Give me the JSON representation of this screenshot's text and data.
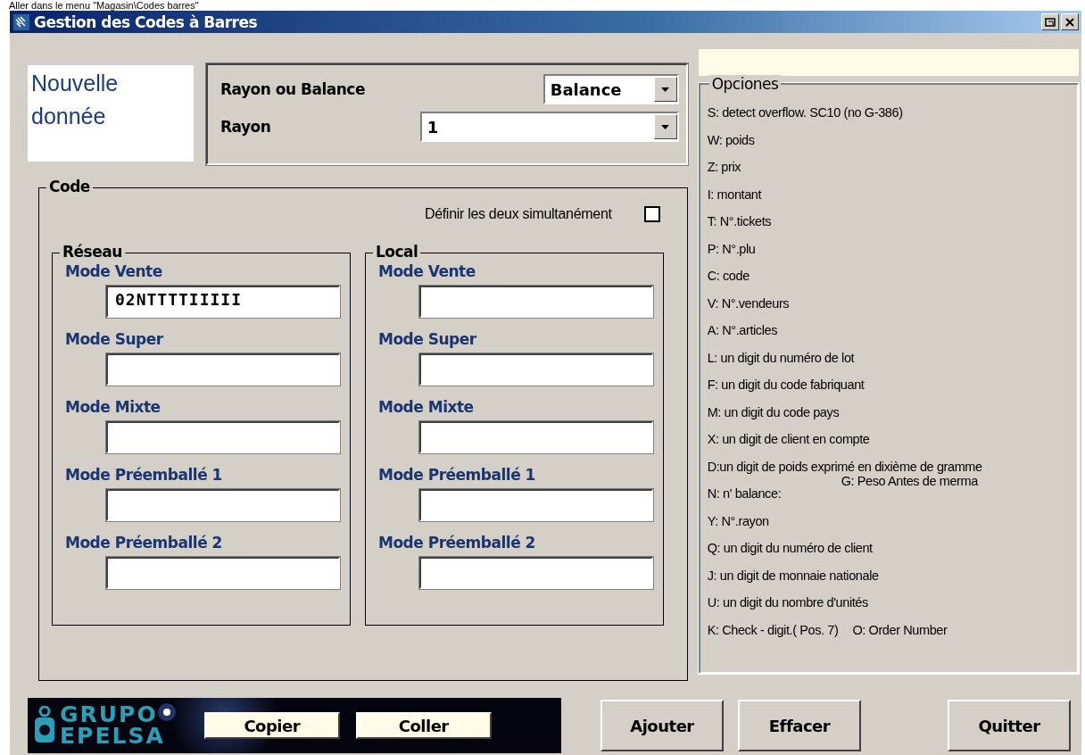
{
  "caption": "Aller dans le menu \"Magasin\\Codes barres\"",
  "window": {
    "title": "Gestion des Codes à Barres"
  },
  "new_entry": {
    "text": "Nouvelle donnée"
  },
  "selector": {
    "rows": [
      {
        "label": "Rayon ou Balance",
        "value": "Balance",
        "kind": "short"
      },
      {
        "label": "Rayon",
        "value": "1",
        "kind": "wide"
      }
    ]
  },
  "code": {
    "title": "Code",
    "both_label": "Définir les deux simultanément",
    "both_checked": false,
    "groups": [
      {
        "title": "Réseau",
        "fields": [
          {
            "label": "Mode Vente",
            "value": "02NTTTTIIIII"
          },
          {
            "label": "Mode Super"
          },
          {
            "label": "Mode Mixte"
          },
          {
            "label": "Mode Préemballé 1"
          },
          {
            "label": "Mode Préemballé 2"
          }
        ]
      },
      {
        "title": "Local",
        "fields": [
          {
            "label": "Mode Vente"
          },
          {
            "label": "Mode Super"
          },
          {
            "label": "Mode Mixte"
          },
          {
            "label": "Mode Préemballé 1"
          },
          {
            "label": "Mode Préemballé 2"
          }
        ]
      }
    ]
  },
  "options": {
    "title": "Opciones",
    "items": [
      {
        "text": "S: detect overflow. SC10 (no G-386)"
      },
      {
        "text": "W: poids"
      },
      {
        "text": "Z: prix"
      },
      {
        "text": "I: montant"
      },
      {
        "text": "T: N°.tickets"
      },
      {
        "text": "P: N°.plu"
      },
      {
        "text": "C: code"
      },
      {
        "text": "V: N°.vendeurs"
      },
      {
        "text": "A: N°.articles"
      },
      {
        "text": "L: un digit du numéro de lot"
      },
      {
        "text": "F: un digit du code fabriquant"
      },
      {
        "text": "M: un digit du code pays"
      },
      {
        "text": "X: un digit de client en compte"
      },
      {
        "text": "D:un digit de poids exprimé en dixième de gramme"
      },
      {
        "text": "N: n' balance:",
        "aside": "G: Peso Antes de merma",
        "kind": "raised"
      },
      {
        "text": "Y: N°.rayon"
      },
      {
        "text": "Q: un digit du numéro de client"
      },
      {
        "text": "J: un digit de monnaie nationale"
      },
      {
        "text": "U: un digit du nombre d'unités"
      },
      {
        "text": "K: Check - digit.( Pos. 7)",
        "aside": "O: Order Number",
        "kind": "inline"
      }
    ]
  },
  "logo": {
    "line1": "GRUPO",
    "line2": "EPELSA"
  },
  "clipboard_buttons": [
    "Copier",
    "Coller"
  ],
  "buttons": [
    "Ajouter",
    "Effacer",
    "Quitter"
  ]
}
